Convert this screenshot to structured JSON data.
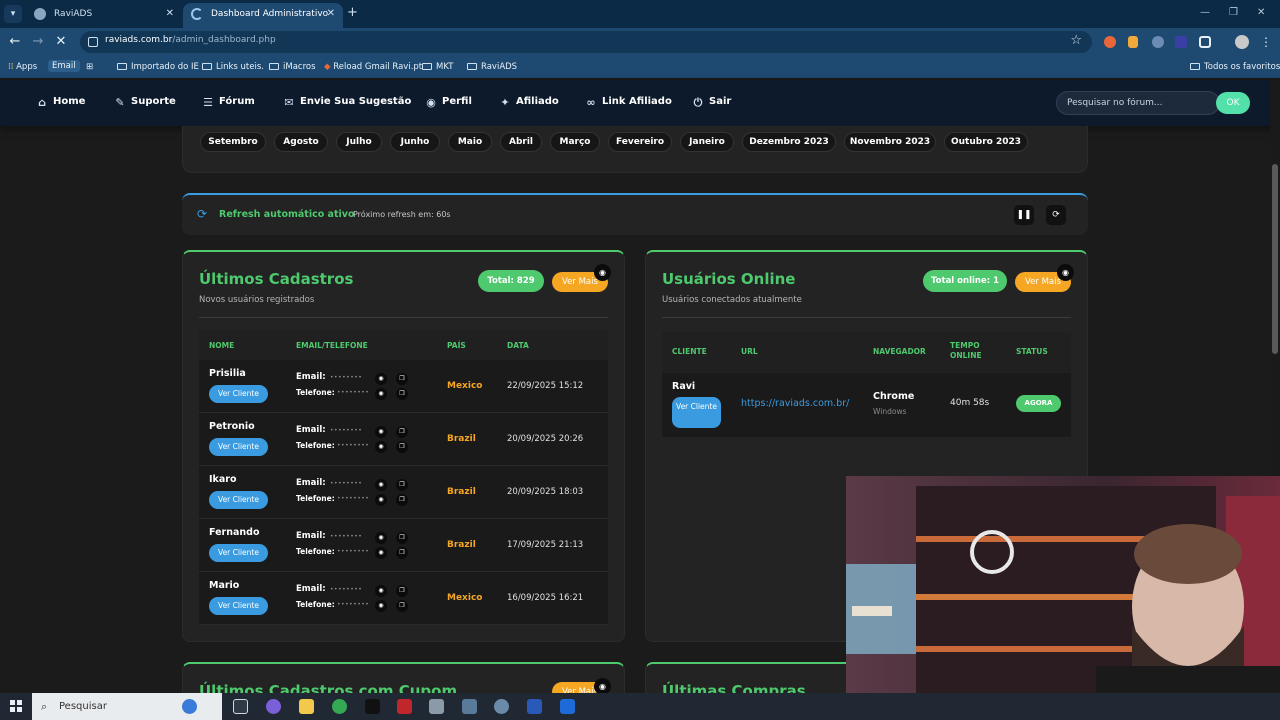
{
  "browser": {
    "tabs": [
      {
        "title": "RaviADS",
        "active": false
      },
      {
        "title": "Dashboard Administrativo",
        "active": true
      }
    ],
    "url_host": "raviads.com.br",
    "url_path": "/admin_dashboard.php",
    "bookmarks": [
      {
        "label": "Apps"
      },
      {
        "label": "Email"
      },
      {
        "label": "Importado do IE"
      },
      {
        "label": "Links uteis."
      },
      {
        "label": "iMacros"
      },
      {
        "label": "Reload Gmail Ravi.pt"
      },
      {
        "label": "MKT"
      },
      {
        "label": "RaviADS"
      }
    ],
    "all_bookmarks": "Todos os favoritos"
  },
  "nav": {
    "items": [
      {
        "label": "Home",
        "icon": "home-icon",
        "glyph": "⌂"
      },
      {
        "label": "Suporte",
        "icon": "support-icon",
        "glyph": "✎"
      },
      {
        "label": "Fórum",
        "icon": "forum-icon",
        "glyph": "☰"
      },
      {
        "label": "Envie Sua Sugestão",
        "icon": "suggestion-icon",
        "glyph": "✉"
      },
      {
        "label": "Perfil",
        "icon": "profile-icon",
        "glyph": "◉"
      },
      {
        "label": "Afiliado",
        "icon": "affiliate-icon",
        "glyph": "✦"
      },
      {
        "label": "Link Afiliado",
        "icon": "link-icon",
        "glyph": "∞"
      },
      {
        "label": "Sair",
        "icon": "logout-icon",
        "glyph": "⏻"
      }
    ],
    "search_placeholder": "Pesquisar no fórum...",
    "search_button": "OK"
  },
  "months": [
    "Setembro",
    "Agosto",
    "Julho",
    "Junho",
    "Maio",
    "Abril",
    "Março",
    "Fevereiro",
    "Janeiro",
    "Dezembro 2023",
    "Novembro 2023",
    "Outubro 2023"
  ],
  "refresh": {
    "title": "Refresh automático ativo",
    "next": "Próximo refresh em: 60s"
  },
  "latest_signups": {
    "title": "Últimos Cadastros",
    "subtitle": "Novos usuários registrados",
    "total": "Total: 829",
    "see_more": "Ver Mais",
    "columns": [
      "NOME",
      "EMAIL/TELEFONE",
      "PAÍS",
      "DATA"
    ],
    "email_label": "Email:",
    "phone_label": "Telefone:",
    "masked": "••••••••",
    "view_client": "Ver Cliente",
    "rows": [
      {
        "name": "Prisilia",
        "country": "Mexico",
        "date": "22/09/2025 15:12"
      },
      {
        "name": "Petronio",
        "country": "Brazil",
        "date": "20/09/2025 20:26"
      },
      {
        "name": "Ikaro",
        "country": "Brazil",
        "date": "20/09/2025 18:03"
      },
      {
        "name": "Fernando",
        "country": "Brazil",
        "date": "17/09/2025 21:13"
      },
      {
        "name": "Mario",
        "country": "Mexico",
        "date": "16/09/2025 16:21"
      }
    ]
  },
  "online_users": {
    "title": "Usuários Online",
    "subtitle": "Usuários conectados atualmente",
    "total": "Total online: 1",
    "see_more": "Ver Mais",
    "columns": [
      "CLIENTE",
      "URL",
      "NAVEGADOR",
      "TEMPO ONLINE",
      "STATUS"
    ],
    "row": {
      "name": "Ravi",
      "view_client": "Ver Cliente",
      "url": "https://raviads.com.br/",
      "browser": "Chrome",
      "os": "Windows",
      "time": "40m 58s",
      "status": "AGORA"
    }
  },
  "bottom_cards": {
    "left_title": "Últimos Cadastros com Cupom",
    "left_see_more": "Ver Mais",
    "right_title": "Últimas Compras"
  },
  "taskbar": {
    "search": "Pesquisar"
  },
  "colors": {
    "accent_green": "#4ec96e",
    "accent_orange": "#f5a623",
    "accent_blue": "#3a9be0"
  }
}
